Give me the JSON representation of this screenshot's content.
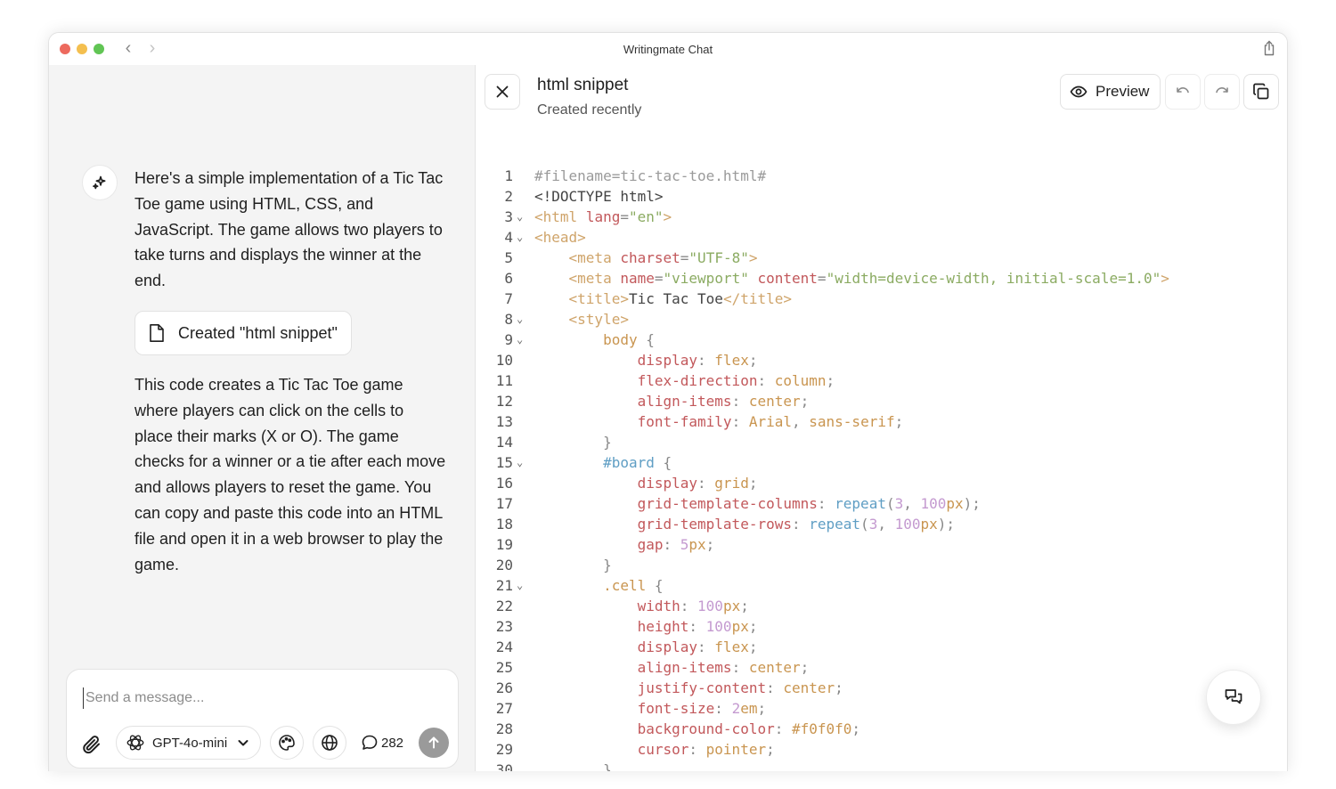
{
  "window": {
    "title": "Writingmate Chat"
  },
  "chat": {
    "message_1": "Here's a simple implementation of a Tic Tac Toe game using HTML, CSS, and JavaScript. The game allows two players to take turns and displays the winner at the end.",
    "artifact_label": "Created \"html snippet\"",
    "message_2": "This code creates a Tic Tac Toe game where players can click on the cells to place their marks (X or O). The game checks for a winner or a tie after each move and allows players to reset the game. You can copy and paste this code into an HTML file and open it in a web browser to play the game.",
    "composer": {
      "placeholder": "Send a message...",
      "model": "GPT-4o-mini",
      "credits": "282"
    }
  },
  "snippet": {
    "title": "html snippet",
    "subtitle": "Created recently",
    "preview_label": "Preview"
  },
  "code": {
    "lines": [
      {
        "n": "1",
        "fold": false,
        "t": [
          [
            "comment",
            "#filename=tic-tac-toe.html#"
          ]
        ]
      },
      {
        "n": "2",
        "fold": false,
        "t": [
          [
            "plain",
            "<!DOCTYPE html>"
          ]
        ]
      },
      {
        "n": "3",
        "fold": true,
        "t": [
          [
            "tag",
            "<html"
          ],
          [
            "plain",
            " "
          ],
          [
            "attr",
            "lang"
          ],
          [
            "punc",
            "="
          ],
          [
            "str",
            "\"en\""
          ],
          [
            "tag",
            ">"
          ]
        ]
      },
      {
        "n": "4",
        "fold": true,
        "t": [
          [
            "tag",
            "<head>"
          ]
        ]
      },
      {
        "n": "5",
        "fold": false,
        "t": [
          [
            "plain",
            "    "
          ],
          [
            "tag",
            "<meta"
          ],
          [
            "plain",
            " "
          ],
          [
            "attr",
            "charset"
          ],
          [
            "punc",
            "="
          ],
          [
            "str",
            "\"UTF-8\""
          ],
          [
            "tag",
            ">"
          ]
        ]
      },
      {
        "n": "6",
        "fold": false,
        "t": [
          [
            "plain",
            "    "
          ],
          [
            "tag",
            "<meta"
          ],
          [
            "plain",
            " "
          ],
          [
            "attr",
            "name"
          ],
          [
            "punc",
            "="
          ],
          [
            "str",
            "\"viewport\""
          ],
          [
            "plain",
            " "
          ],
          [
            "attr",
            "content"
          ],
          [
            "punc",
            "="
          ],
          [
            "str",
            "\"width=device-width, initial-scale=1.0\""
          ],
          [
            "tag",
            ">"
          ]
        ]
      },
      {
        "n": "7",
        "fold": false,
        "t": [
          [
            "plain",
            "    "
          ],
          [
            "tag",
            "<title>"
          ],
          [
            "plain",
            "Tic Tac Toe"
          ],
          [
            "tag",
            "</title>"
          ]
        ]
      },
      {
        "n": "8",
        "fold": true,
        "t": [
          [
            "plain",
            "    "
          ],
          [
            "tag",
            "<style>"
          ]
        ]
      },
      {
        "n": "9",
        "fold": true,
        "t": [
          [
            "plain",
            "        "
          ],
          [
            "sel",
            "body"
          ],
          [
            "punc",
            " {"
          ]
        ]
      },
      {
        "n": "10",
        "fold": false,
        "t": [
          [
            "plain",
            "            "
          ],
          [
            "prop",
            "display"
          ],
          [
            "punc",
            ": "
          ],
          [
            "val",
            "flex"
          ],
          [
            "punc",
            ";"
          ]
        ]
      },
      {
        "n": "11",
        "fold": false,
        "t": [
          [
            "plain",
            "            "
          ],
          [
            "prop",
            "flex-direction"
          ],
          [
            "punc",
            ": "
          ],
          [
            "val",
            "column"
          ],
          [
            "punc",
            ";"
          ]
        ]
      },
      {
        "n": "12",
        "fold": false,
        "t": [
          [
            "plain",
            "            "
          ],
          [
            "prop",
            "align-items"
          ],
          [
            "punc",
            ": "
          ],
          [
            "val",
            "center"
          ],
          [
            "punc",
            ";"
          ]
        ]
      },
      {
        "n": "13",
        "fold": false,
        "t": [
          [
            "plain",
            "            "
          ],
          [
            "prop",
            "font-family"
          ],
          [
            "punc",
            ": "
          ],
          [
            "val",
            "Arial"
          ],
          [
            "punc",
            ", "
          ],
          [
            "val",
            "sans-serif"
          ],
          [
            "punc",
            ";"
          ]
        ]
      },
      {
        "n": "14",
        "fold": false,
        "t": [
          [
            "plain",
            "        "
          ],
          [
            "punc",
            "}"
          ]
        ]
      },
      {
        "n": "15",
        "fold": true,
        "t": [
          [
            "plain",
            "        "
          ],
          [
            "id",
            "#board"
          ],
          [
            "punc",
            " {"
          ]
        ]
      },
      {
        "n": "16",
        "fold": false,
        "t": [
          [
            "plain",
            "            "
          ],
          [
            "prop",
            "display"
          ],
          [
            "punc",
            ": "
          ],
          [
            "val",
            "grid"
          ],
          [
            "punc",
            ";"
          ]
        ]
      },
      {
        "n": "17",
        "fold": false,
        "t": [
          [
            "plain",
            "            "
          ],
          [
            "prop",
            "grid-template-columns"
          ],
          [
            "punc",
            ": "
          ],
          [
            "fn",
            "repeat"
          ],
          [
            "punc",
            "("
          ],
          [
            "num",
            "3"
          ],
          [
            "punc",
            ", "
          ],
          [
            "num",
            "100"
          ],
          [
            "val",
            "px"
          ],
          [
            "punc",
            ");"
          ]
        ]
      },
      {
        "n": "18",
        "fold": false,
        "t": [
          [
            "plain",
            "            "
          ],
          [
            "prop",
            "grid-template-rows"
          ],
          [
            "punc",
            ": "
          ],
          [
            "fn",
            "repeat"
          ],
          [
            "punc",
            "("
          ],
          [
            "num",
            "3"
          ],
          [
            "punc",
            ", "
          ],
          [
            "num",
            "100"
          ],
          [
            "val",
            "px"
          ],
          [
            "punc",
            ");"
          ]
        ]
      },
      {
        "n": "19",
        "fold": false,
        "t": [
          [
            "plain",
            "            "
          ],
          [
            "prop",
            "gap"
          ],
          [
            "punc",
            ": "
          ],
          [
            "num",
            "5"
          ],
          [
            "val",
            "px"
          ],
          [
            "punc",
            ";"
          ]
        ]
      },
      {
        "n": "20",
        "fold": false,
        "t": [
          [
            "plain",
            "        "
          ],
          [
            "punc",
            "}"
          ]
        ]
      },
      {
        "n": "21",
        "fold": true,
        "t": [
          [
            "plain",
            "        "
          ],
          [
            "sel",
            ".cell"
          ],
          [
            "punc",
            " {"
          ]
        ]
      },
      {
        "n": "22",
        "fold": false,
        "t": [
          [
            "plain",
            "            "
          ],
          [
            "prop",
            "width"
          ],
          [
            "punc",
            ": "
          ],
          [
            "num",
            "100"
          ],
          [
            "val",
            "px"
          ],
          [
            "punc",
            ";"
          ]
        ]
      },
      {
        "n": "23",
        "fold": false,
        "t": [
          [
            "plain",
            "            "
          ],
          [
            "prop",
            "height"
          ],
          [
            "punc",
            ": "
          ],
          [
            "num",
            "100"
          ],
          [
            "val",
            "px"
          ],
          [
            "punc",
            ";"
          ]
        ]
      },
      {
        "n": "24",
        "fold": false,
        "t": [
          [
            "plain",
            "            "
          ],
          [
            "prop",
            "display"
          ],
          [
            "punc",
            ": "
          ],
          [
            "val",
            "flex"
          ],
          [
            "punc",
            ";"
          ]
        ]
      },
      {
        "n": "25",
        "fold": false,
        "t": [
          [
            "plain",
            "            "
          ],
          [
            "prop",
            "align-items"
          ],
          [
            "punc",
            ": "
          ],
          [
            "val",
            "center"
          ],
          [
            "punc",
            ";"
          ]
        ]
      },
      {
        "n": "26",
        "fold": false,
        "t": [
          [
            "plain",
            "            "
          ],
          [
            "prop",
            "justify-content"
          ],
          [
            "punc",
            ": "
          ],
          [
            "val",
            "center"
          ],
          [
            "punc",
            ";"
          ]
        ]
      },
      {
        "n": "27",
        "fold": false,
        "t": [
          [
            "plain",
            "            "
          ],
          [
            "prop",
            "font-size"
          ],
          [
            "punc",
            ": "
          ],
          [
            "num",
            "2"
          ],
          [
            "val",
            "em"
          ],
          [
            "punc",
            ";"
          ]
        ]
      },
      {
        "n": "28",
        "fold": false,
        "t": [
          [
            "plain",
            "            "
          ],
          [
            "prop",
            "background-color"
          ],
          [
            "punc",
            ": "
          ],
          [
            "val",
            "#f0f0f0"
          ],
          [
            "punc",
            ";"
          ]
        ]
      },
      {
        "n": "29",
        "fold": false,
        "t": [
          [
            "plain",
            "            "
          ],
          [
            "prop",
            "cursor"
          ],
          [
            "punc",
            ": "
          ],
          [
            "val",
            "pointer"
          ],
          [
            "punc",
            ";"
          ]
        ]
      },
      {
        "n": "30",
        "fold": false,
        "t": [
          [
            "plain",
            "        "
          ],
          [
            "punc",
            "}"
          ]
        ]
      }
    ]
  },
  "colors": {
    "send_button": "#9a9a9a",
    "chat_background": "#f4f4f4"
  },
  "icons": {
    "avatar": "sparkle-icon",
    "artifact": "document-icon",
    "attach": "paperclip-icon",
    "model": "openai-icon",
    "palette": "palette-icon",
    "globe": "globe-icon",
    "credits": "speech-bubble-icon",
    "send": "arrow-up-icon",
    "close": "close-icon",
    "preview": "eye-icon",
    "undo": "undo-icon",
    "redo": "redo-icon",
    "copy": "copy-icon",
    "chat_fab": "chat-bubbles-icon"
  }
}
